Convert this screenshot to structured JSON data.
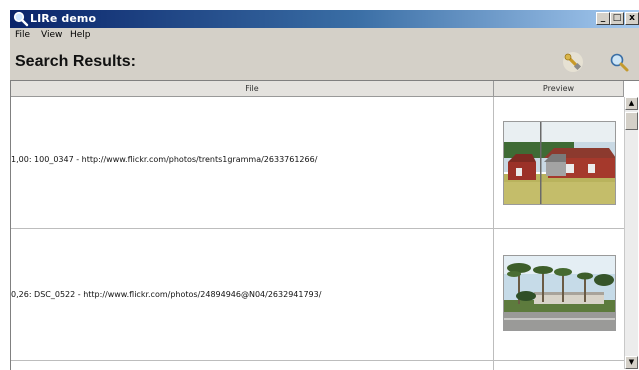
{
  "window": {
    "title": "LIRe demo",
    "controls": [
      "_",
      "□",
      "x"
    ]
  },
  "menu": {
    "items": [
      "File",
      "View",
      "Help"
    ]
  },
  "header": {
    "title": "Search Results:",
    "tools": [
      "wrench-icon",
      "search-icon"
    ]
  },
  "table": {
    "columns": [
      "File",
      "Preview"
    ],
    "rows": [
      {
        "text": "1,00: 100_0347 - http://www.flickr.com/photos/trents1gramma/2633761266/",
        "preview": "barn-photo"
      },
      {
        "text": "0,26: DSC_0522 - http://www.flickr.com/photos/24894946@N04/2632941793/",
        "preview": "palm-trees-photo"
      }
    ]
  }
}
